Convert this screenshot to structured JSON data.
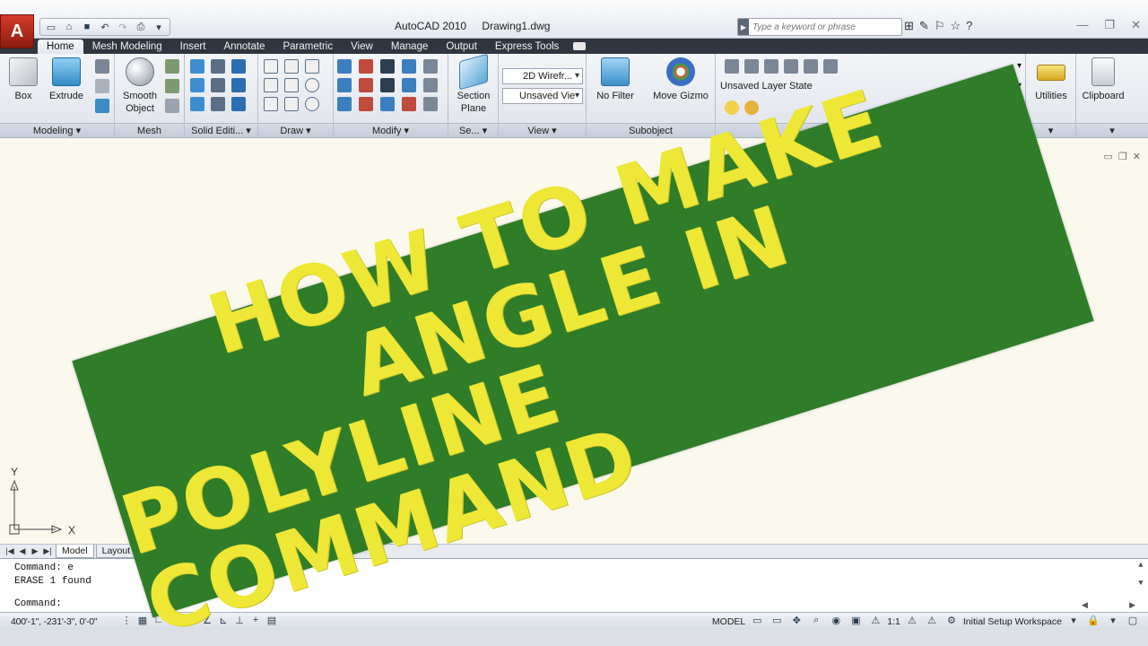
{
  "titlebar": {
    "app_name": "AutoCAD 2010",
    "file_name": "Drawing1.dwg",
    "search_placeholder": "Type a keyword or phrase",
    "app_button": "A"
  },
  "tabs": [
    "Home",
    "Mesh Modeling",
    "Insert",
    "Annotate",
    "Parametric",
    "View",
    "Manage",
    "Output",
    "Express Tools"
  ],
  "ribbon": {
    "box": "Box",
    "extrude": "Extrude",
    "smooth_object": "Smooth Object",
    "section_plane": "Section Plane",
    "visual_style": "2D Wirefr...",
    "saved_view": "Unsaved Vie",
    "no_filter": "No Filter",
    "move_gizmo": "Move Gizmo",
    "layer_state": "Unsaved Layer State",
    "utilities": "Utilities",
    "clipboard": "Clipboard",
    "panels": {
      "modeling": "Modeling",
      "mesh": "Mesh",
      "solid_editing": "Solid Editi...",
      "draw": "Draw",
      "modify": "Modify",
      "section": "Se...",
      "view": "View",
      "subobject": "Subobject"
    }
  },
  "canvas": {
    "ucs_y": "Y",
    "ucs_x": "X"
  },
  "layout_tabs": [
    "Model",
    "Layout"
  ],
  "command": {
    "line1": "Command: e",
    "line2": "ERASE 1 found",
    "prompt": "Command:"
  },
  "status": {
    "coords": "400'-1\",  -231'-3\", 0'-0\"",
    "model": "MODEL",
    "scale": "1:1",
    "workspace": "Initial Setup Workspace"
  },
  "banner": {
    "line1": "HOW TO MAKE",
    "line2": "ANGLE IN",
    "line3": "POLYLINE COMMAND"
  },
  "colors": {
    "banner_green": "#2f7d28",
    "banner_text": "#eee735",
    "ribbon_tab_bar": "#2f3640",
    "canvas_bg": "#fbf9ee"
  }
}
